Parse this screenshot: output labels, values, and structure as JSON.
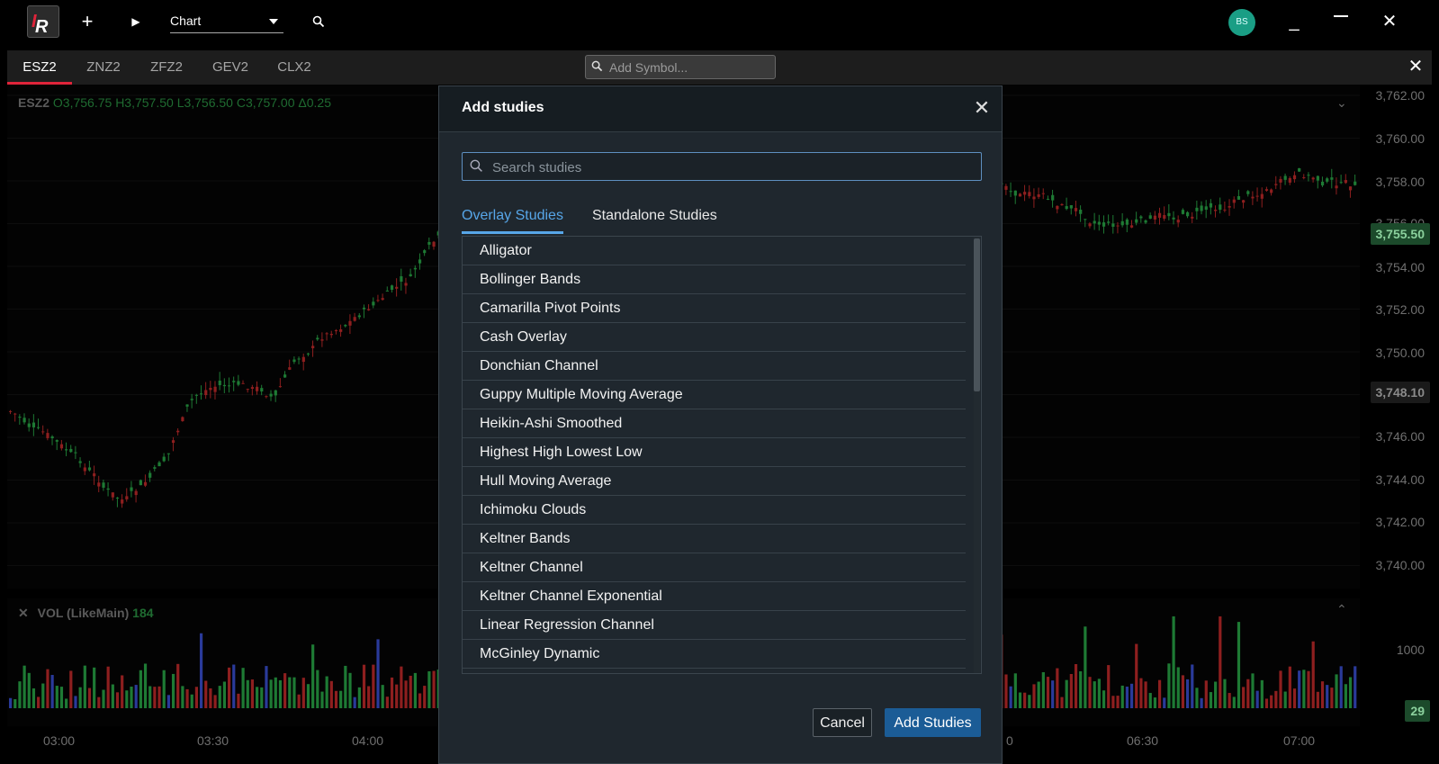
{
  "app": {
    "logo_text": "R",
    "logo_accent": "I",
    "layout_select": "Chart",
    "avatar_initials": "BS"
  },
  "tabs": [
    {
      "label": "ESZ2",
      "active": true
    },
    {
      "label": "ZNZ2",
      "active": false
    },
    {
      "label": "ZFZ2",
      "active": false
    },
    {
      "label": "GEV2",
      "active": false
    },
    {
      "label": "CLX2",
      "active": false
    }
  ],
  "symbol_search": {
    "placeholder": "Add Symbol..."
  },
  "chart": {
    "symbol": "ESZ2",
    "open": "O3,756.75",
    "high": "H3,757.50",
    "low": "L3,756.50",
    "close": "C3,757.00",
    "change": "Δ0.25",
    "price_labels": [
      "3,762.00",
      "3,760.00",
      "3,758.00",
      "3,756.00",
      "3,754.00",
      "3,752.00",
      "3,750.00",
      "3,746.00",
      "3,744.00",
      "3,742.00",
      "3,740.00"
    ],
    "last_price": "3,755.50",
    "crosshair_price": "3,748.10",
    "volume_title": "VOL (LikeMain)",
    "volume_value": "184",
    "volume_axis_label": "1000",
    "volume_tag": "29",
    "time_labels": [
      "03:00",
      "03:30",
      "04:00",
      "0",
      "06:30",
      "07:00"
    ],
    "colors": {
      "up": "#1e7a34",
      "down": "#8e1f1f",
      "neutral": "#2a3a9a",
      "price_tag": "#1c4a2b"
    }
  },
  "modal": {
    "title": "Add studies",
    "search_placeholder": "Search studies",
    "tabs": [
      {
        "label": "Overlay Studies",
        "active": true
      },
      {
        "label": "Standalone Studies",
        "active": false
      }
    ],
    "studies": [
      "Alligator",
      "Bollinger Bands",
      "Camarilla Pivot Points",
      "Cash Overlay",
      "Donchian Channel",
      "Guppy Multiple Moving Average",
      "Heikin-Ashi Smoothed",
      "Highest High Lowest Low",
      "Hull Moving Average",
      "Ichimoku Clouds",
      "Keltner Bands",
      "Keltner Channel",
      "Keltner Channel Exponential",
      "Linear Regression Channel",
      "McGinley Dynamic"
    ],
    "cancel_label": "Cancel",
    "add_label": "Add Studies",
    "accent": "#57a6e8",
    "button_color": "#1b5c96"
  }
}
